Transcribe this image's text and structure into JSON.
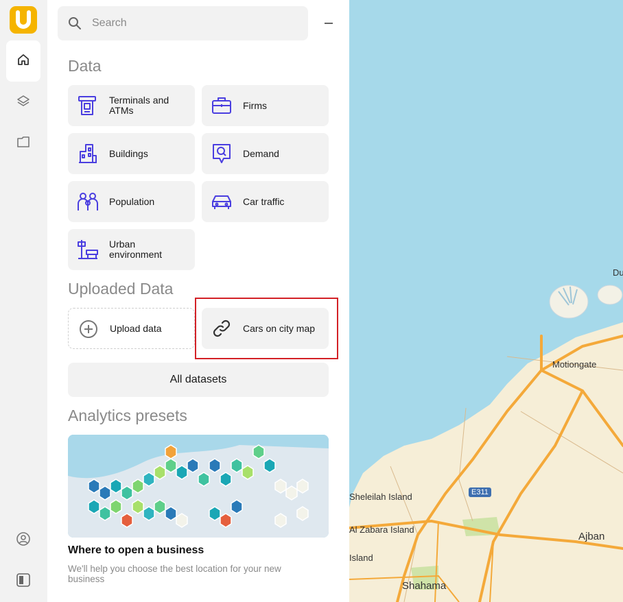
{
  "search": {
    "placeholder": "Search"
  },
  "sections": {
    "data_title": "Data",
    "uploaded_title": "Uploaded Data",
    "presets_title": "Analytics presets"
  },
  "data_tiles": [
    {
      "label": "Terminals and ATMs",
      "icon": "terminal-atm-icon"
    },
    {
      "label": "Firms",
      "icon": "briefcase-icon"
    },
    {
      "label": "Buildings",
      "icon": "buildings-icon"
    },
    {
      "label": "Demand",
      "icon": "demand-search-icon"
    },
    {
      "label": "Population",
      "icon": "population-icon"
    },
    {
      "label": "Car traffic",
      "icon": "car-icon"
    },
    {
      "label": "Urban environment",
      "icon": "urban-environment-icon"
    }
  ],
  "uploaded": {
    "upload_label": "Upload data",
    "dataset_label": "Cars on city map"
  },
  "all_datasets_label": "All datasets",
  "preset": {
    "title": "Where to open a business",
    "description": "We'll help you choose the best location for your new business"
  },
  "map": {
    "labels": [
      "Motiongate",
      "Sheleilah Island",
      "Al Zabara Island",
      "Ajban",
      "Shahama",
      "Du",
      "Island"
    ],
    "road_shield": "E311"
  },
  "colors": {
    "accent": "#5b3df5",
    "logo": "#f5b400",
    "highlight": "#d32026",
    "water": "#a6d9ea",
    "land": "#f6eed7",
    "road": "#f4a93a"
  }
}
